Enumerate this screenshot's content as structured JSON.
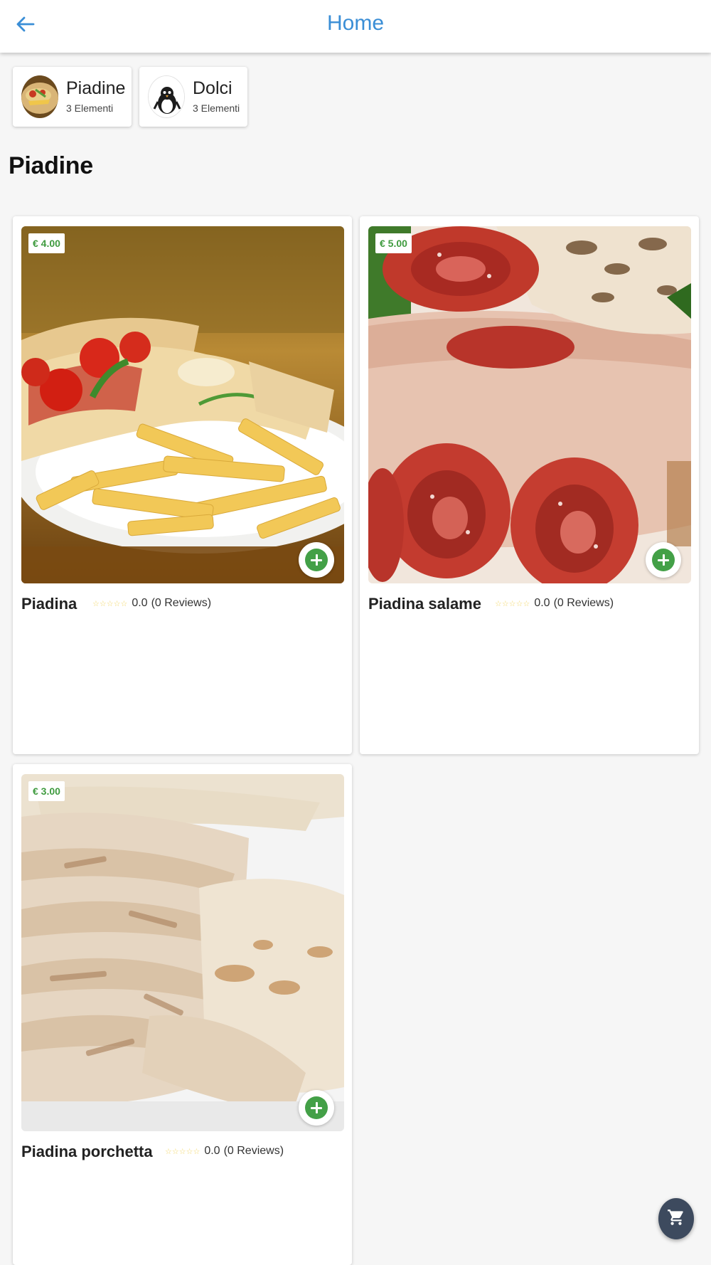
{
  "appbar": {
    "title": "Home",
    "back_icon": "arrow-left-icon",
    "title_color": "#3a8ed6"
  },
  "categories": [
    {
      "name": "Piadine",
      "count": "3 Elementi",
      "icon": "piadina-thumbnail"
    },
    {
      "name": "Dolci",
      "count": "3 Elementi",
      "icon": "penguin-thumbnail"
    }
  ],
  "section": {
    "title": "Piadine"
  },
  "products": [
    {
      "name": "Piadina",
      "price": "€ 4.00",
      "stars": "☆☆☆☆☆",
      "rating": "0.0",
      "reviews": "(0 Reviews)",
      "image": "piadina-with-fries-photo"
    },
    {
      "name": "Piadina salame",
      "price": "€ 5.00",
      "stars": "☆☆☆☆☆",
      "rating": "0.0",
      "reviews": "(0 Reviews)",
      "image": "piadina-salame-photo"
    },
    {
      "name": "Piadina porchetta",
      "price": "€ 3.00",
      "stars": "☆☆☆☆☆",
      "rating": "0.0",
      "reviews": "(0 Reviews)",
      "image": "piadina-porchetta-photo"
    }
  ],
  "cart": {
    "icon": "cart-icon"
  },
  "colors": {
    "accent": "#3a8ed6",
    "price": "#3f9b3f",
    "add_button": "#43a047",
    "fab": "#3d4a5e",
    "star": "#f3d86b"
  }
}
